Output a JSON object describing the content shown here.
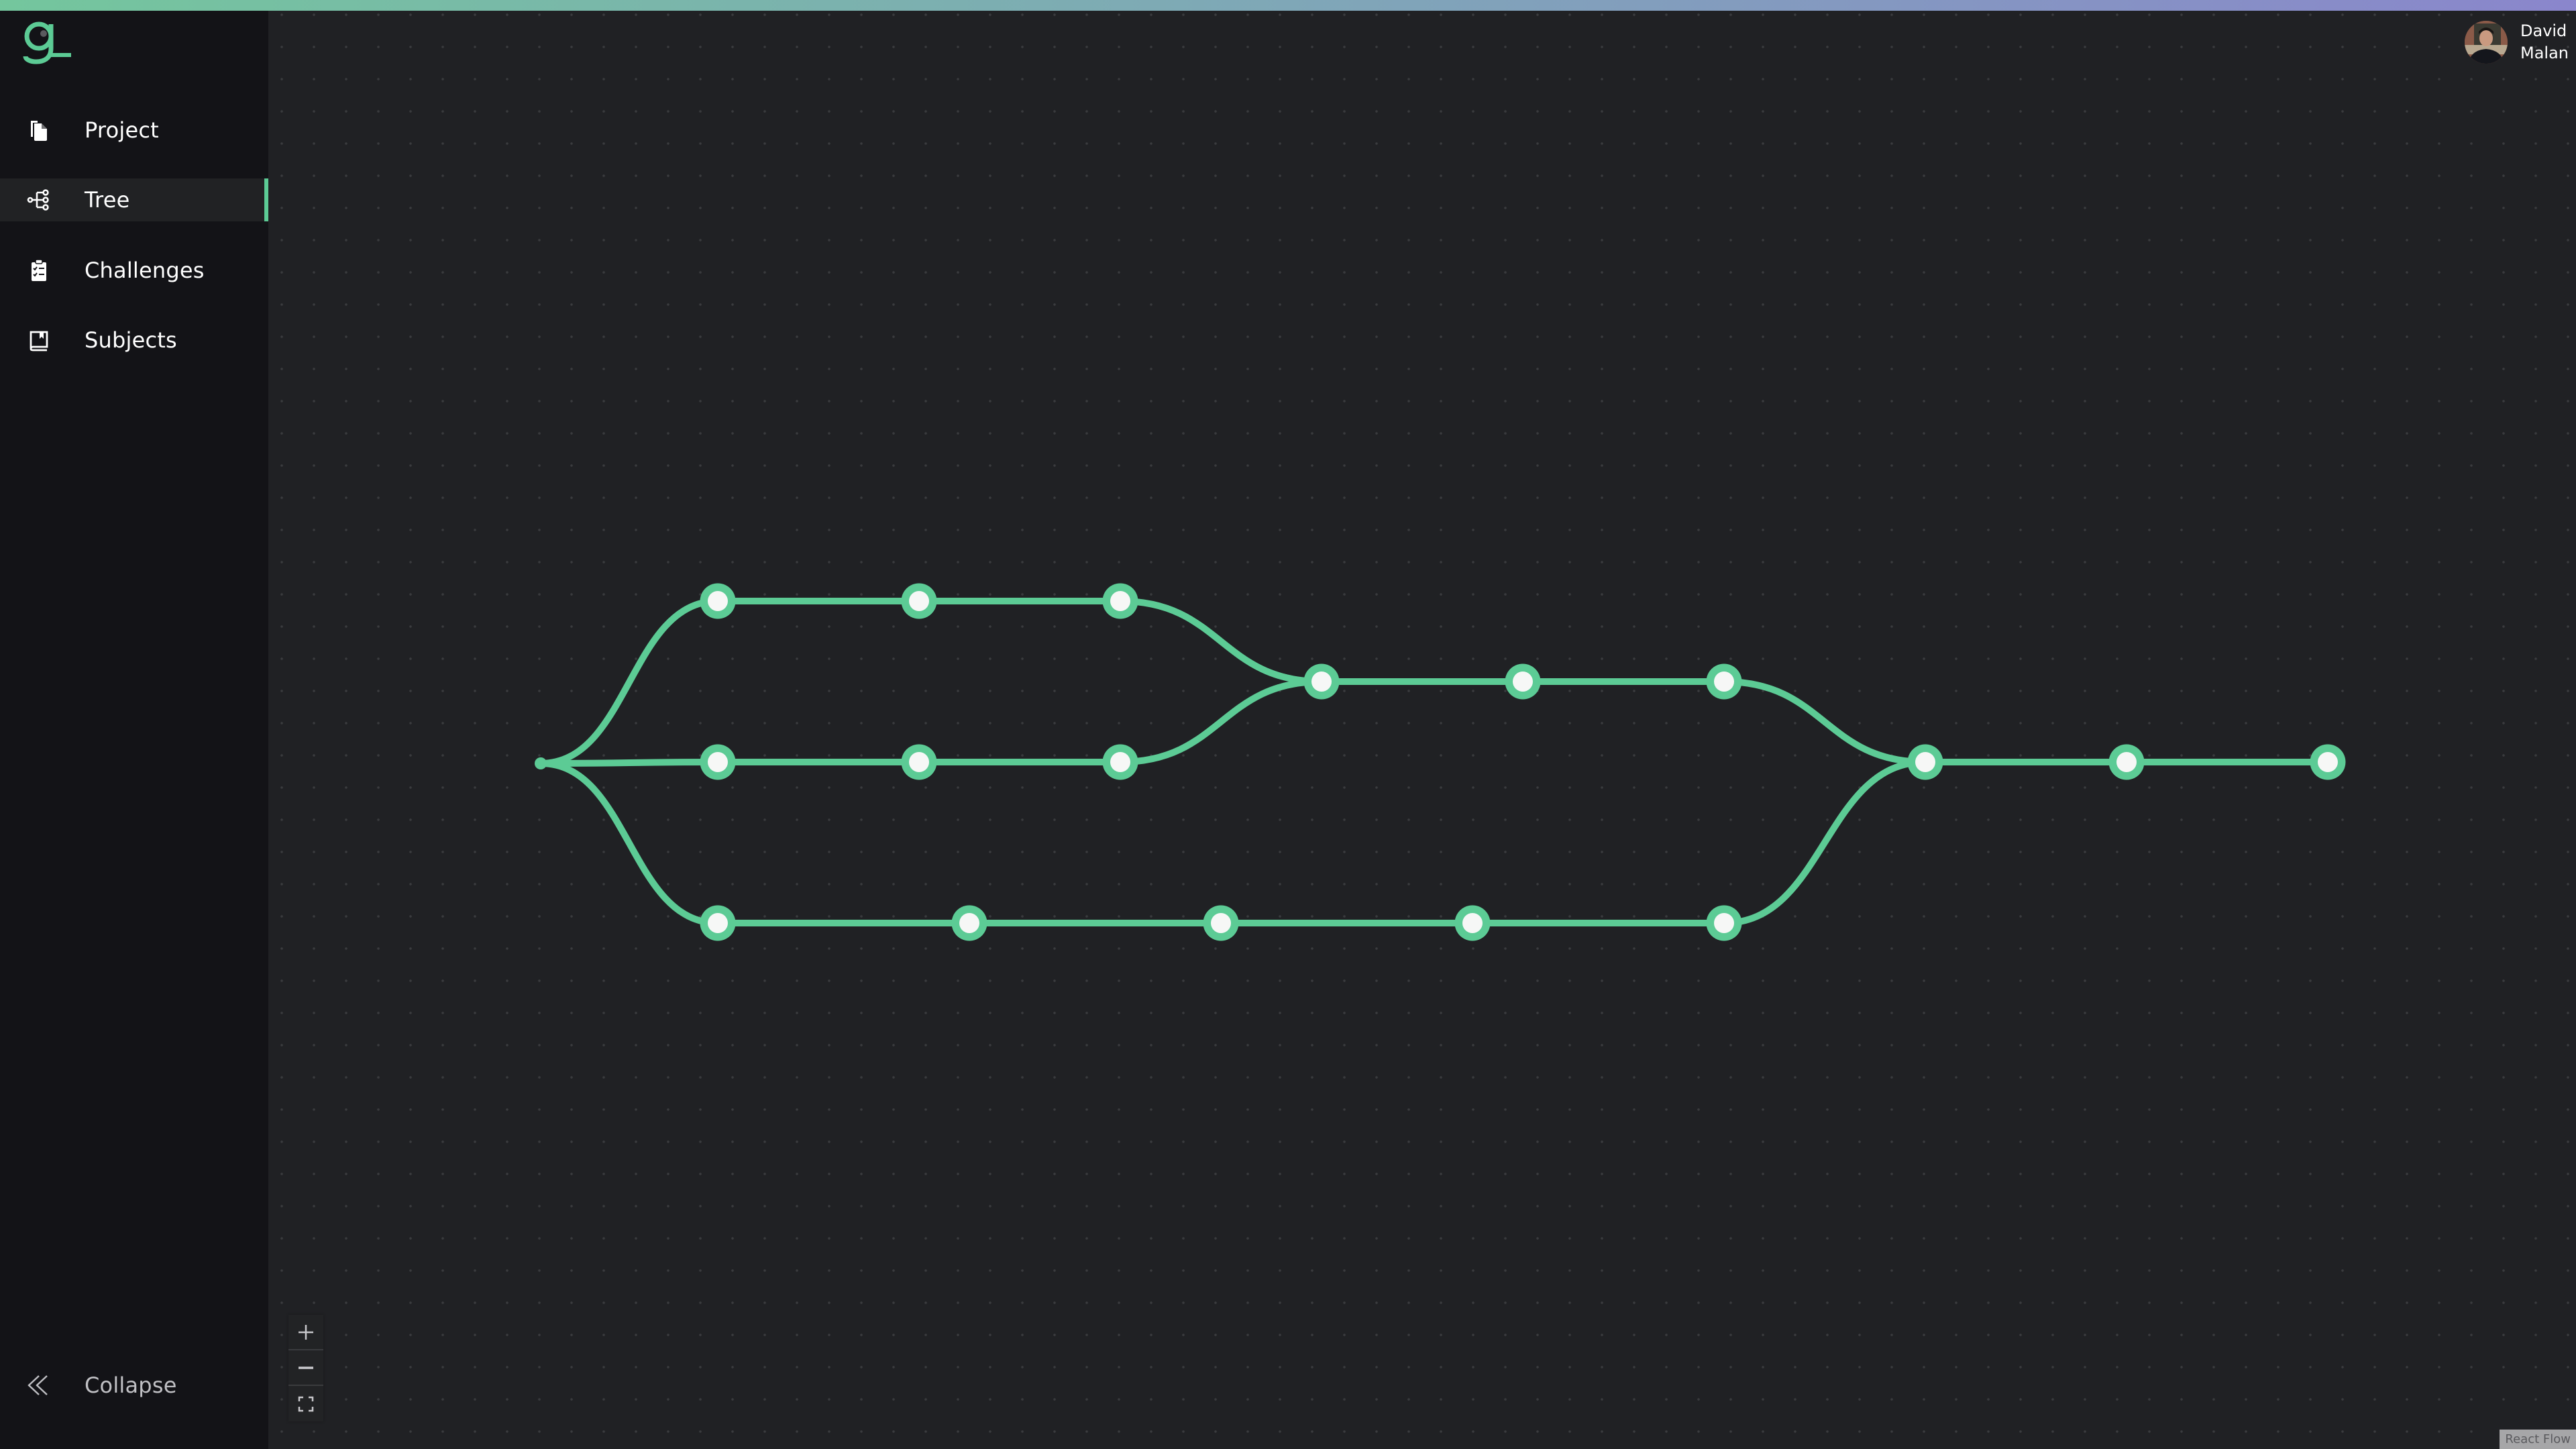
{
  "app": {
    "brand_colors": {
      "accent": "#5ccb95",
      "gradient_start": "#74c69d",
      "gradient_end": "#8a86cc"
    }
  },
  "sidebar": {
    "logo": "g-logo-icon",
    "items": [
      {
        "label": "Project",
        "icon": "document-copy-icon",
        "active": false
      },
      {
        "label": "Tree",
        "icon": "tree-icon",
        "active": true
      },
      {
        "label": "Challenges",
        "icon": "clipboard-checklist-icon",
        "active": false
      },
      {
        "label": "Subjects",
        "icon": "book-icon",
        "active": false
      }
    ],
    "collapse_label": "Collapse",
    "collapse_icon": "chevrons-left-icon"
  },
  "user": {
    "first_name": "David",
    "last_name": "Malan"
  },
  "flow": {
    "edge_color": "#5ccb95",
    "node_fill": "#f6f7f6",
    "root": "start",
    "nodes": [
      {
        "id": "start",
        "type": "root"
      },
      {
        "id": "a1"
      },
      {
        "id": "a2"
      },
      {
        "id": "a3"
      },
      {
        "id": "b1"
      },
      {
        "id": "b2"
      },
      {
        "id": "b3"
      },
      {
        "id": "c1"
      },
      {
        "id": "c2"
      },
      {
        "id": "c3"
      },
      {
        "id": "c4"
      },
      {
        "id": "c5"
      },
      {
        "id": "m1"
      },
      {
        "id": "m2"
      },
      {
        "id": "m3"
      },
      {
        "id": "f1"
      },
      {
        "id": "f2"
      },
      {
        "id": "f3"
      }
    ],
    "edges": [
      [
        "start",
        "a1"
      ],
      [
        "a1",
        "a2"
      ],
      [
        "a2",
        "a3"
      ],
      [
        "a3",
        "m1"
      ],
      [
        "start",
        "b1"
      ],
      [
        "b1",
        "b2"
      ],
      [
        "b2",
        "b3"
      ],
      [
        "b3",
        "m1"
      ],
      [
        "m1",
        "m2"
      ],
      [
        "m2",
        "m3"
      ],
      [
        "m3",
        "f1"
      ],
      [
        "start",
        "c1"
      ],
      [
        "c1",
        "c2"
      ],
      [
        "c2",
        "c3"
      ],
      [
        "c3",
        "c4"
      ],
      [
        "c4",
        "c5"
      ],
      [
        "c5",
        "f1"
      ],
      [
        "f1",
        "f2"
      ],
      [
        "f2",
        "f3"
      ]
    ]
  },
  "controls": {
    "zoom_in": "plus-icon",
    "zoom_out": "minus-icon",
    "fit_view": "fit-view-icon"
  },
  "attribution": "React Flow"
}
